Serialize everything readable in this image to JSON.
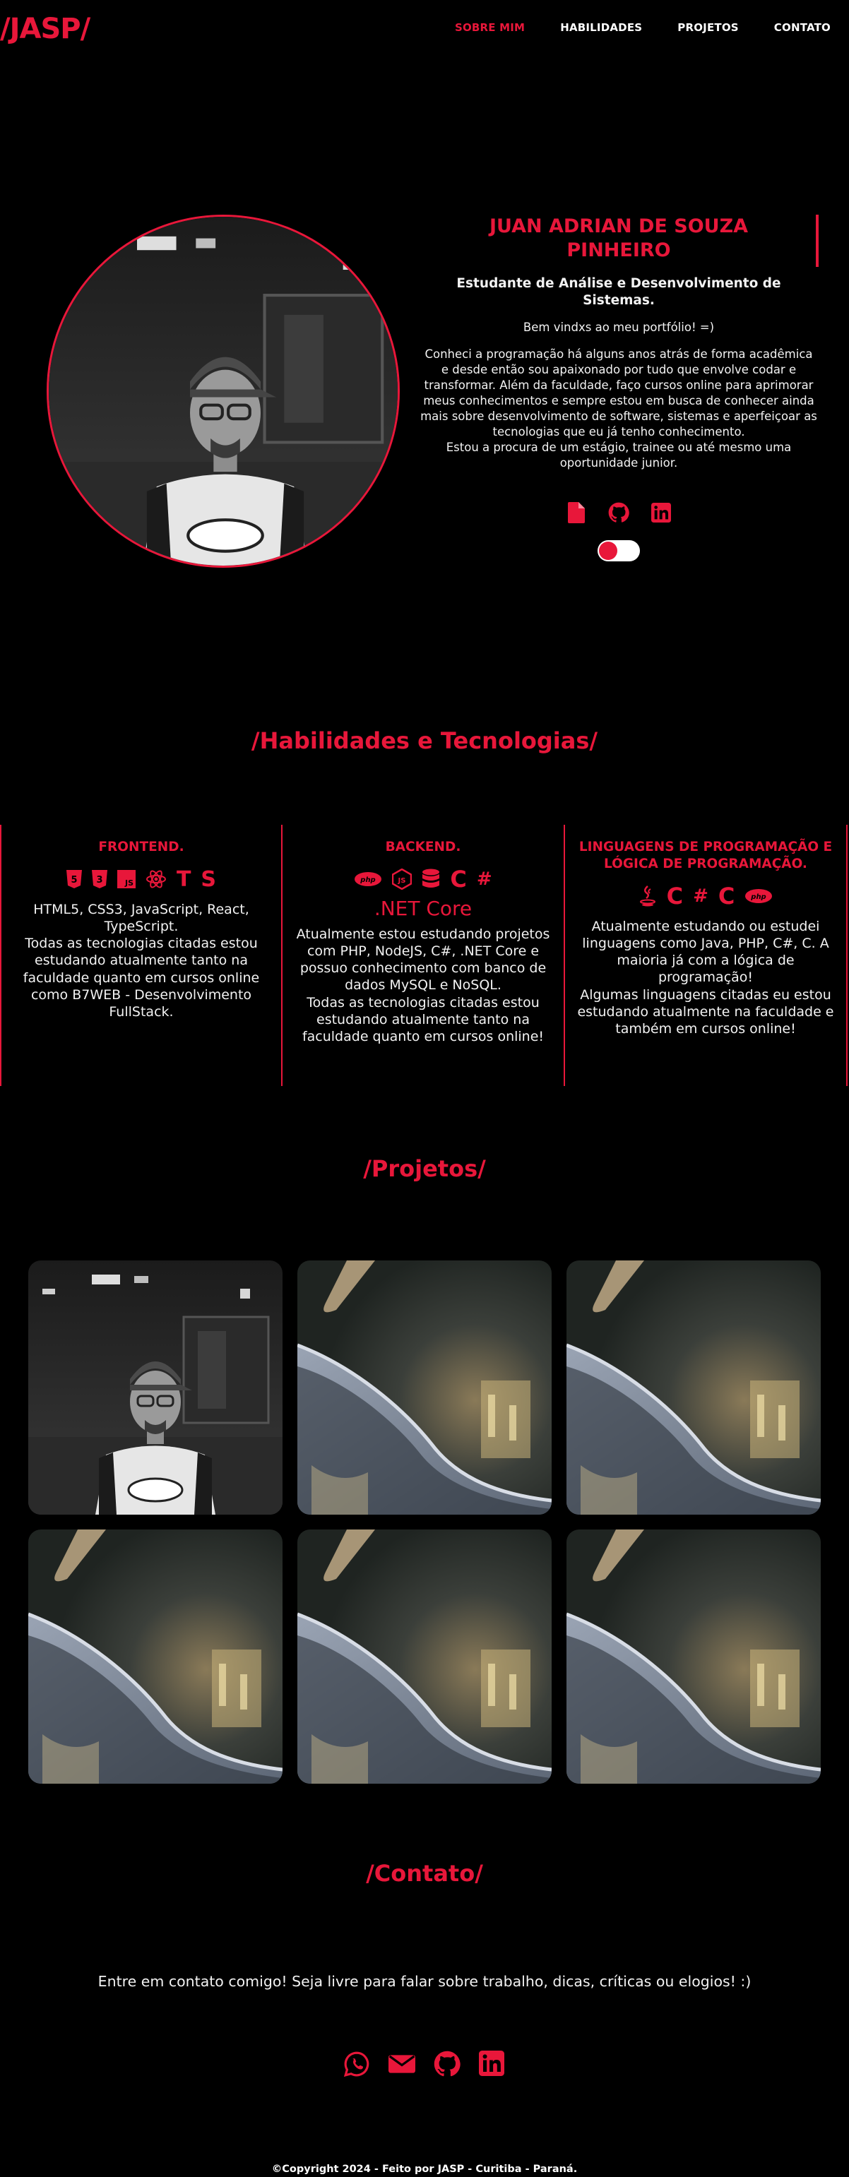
{
  "nav": {
    "logo": "/JASP/",
    "links": [
      "SOBRE MIM",
      "HABILIDADES",
      "PROJETOS",
      "CONTATO"
    ]
  },
  "hero": {
    "name": "JUAN ADRIAN DE SOUZA PINHEIRO",
    "subtitle": "Estudante de Análise e Desenvolvimento de Sistemas.",
    "hello": "Bem vindxs ao meu portfólio! =)",
    "bio": "Conheci a programação há alguns anos atrás de forma acadêmica e desde então sou apaixonado por tudo que envolve codar e transformar. Além da faculdade, faço cursos online para aprimorar meus conhecimentos e sempre estou em busca de conhecer ainda mais sobre desenvolvimento de software, sistemas e aperfeiçoar as tecnologias que eu já tenho conhecimento.",
    "bio2": "Estou a procura de um estágio, trainee ou até mesmo uma oportunidade junior.",
    "icons": [
      "file-icon",
      "github-icon",
      "linkedin-icon"
    ],
    "toggle_on": true
  },
  "skills_title": "/Habilidades e Tecnologias/",
  "skills": [
    {
      "title": "FRONTEND.",
      "icons": [
        "html5-icon",
        "css3-icon",
        "js-icon",
        "react-icon",
        "typescript-icon",
        "styled-components-icon"
      ],
      "text": "HTML5, CSS3, JavaScript, React, TypeScript.\nTodas as tecnologias citadas estou estudando atualmente tanto na faculdade quanto em cursos online como B7WEB - Desenvolvimento FullStack."
    },
    {
      "title": "BACKEND.",
      "icons": [
        "php-icon",
        "nodejs-icon",
        "database-icon",
        "c-icon",
        "csharp-icon"
      ],
      "extra": ".NET Core",
      "text": "Atualmente estou estudando projetos com PHP, NodeJS, C#, .NET Core e possuo conhecimento com banco de dados MySQL e NoSQL.\nTodas as tecnologias citadas estou estudando atualmente tanto na faculdade quanto em cursos online!"
    },
    {
      "title": "LINGUAGENS DE PROGRAMAÇÃO E LÓGICA DE PROGRAMAÇÃO.",
      "icons": [
        "java-icon",
        "c-icon",
        "csharp-icon",
        "c-icon",
        "php-icon"
      ],
      "text": "Atualmente estudando ou estudei linguagens como Java, PHP, C#, C. A maioria já com a lógica de programação!\nAlgumas linguagens citadas eu estou estudando atualmente na faculdade e também em cursos online!"
    }
  ],
  "projects_title": "/Projetos/",
  "projects": [
    "portrait",
    "boat",
    "boat",
    "boat",
    "boat",
    "boat"
  ],
  "contact_title": "/Contato/",
  "contact_text": "Entre em contato comigo! Seja livre para falar sobre trabalho, dicas, críticas ou elogios! :)",
  "contact_icons": [
    "whatsapp-icon",
    "email-icon",
    "github-icon",
    "linkedin-icon"
  ],
  "footer": "©Copyright 2024 - Feito por JASP - Curitiba - Paraná.",
  "colors": {
    "accent": "#e8173a",
    "background": "#000000",
    "text": "#ffffff"
  }
}
